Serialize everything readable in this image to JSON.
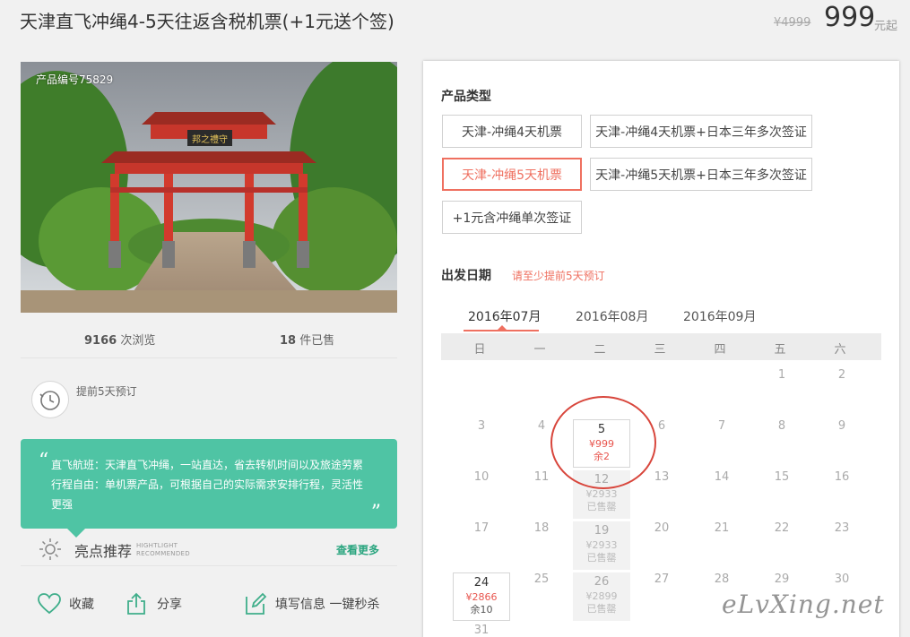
{
  "header": {
    "title": "天津直飞冲绳4-5天往返含税机票(+1元送个签)",
    "price_old": "¥4999",
    "price_now": "999",
    "price_unit": "元起"
  },
  "product": {
    "code_label": "产品编号75829",
    "views_count": "9166",
    "views_label": " 次浏览",
    "sold_count": "18",
    "sold_label": " 件已售",
    "advance_text": "提前5天预订",
    "intro_lines": [
      "直飞航班：天津直飞冲绳，一站直达，省去转机时间以及旅途劳累",
      "行程自由：单机票产品，可根据自己的实际需求安排行程，灵活性",
      "更强"
    ],
    "highlight_title": "亮点推荐",
    "highlight_en_1": "HIGHTLIGHT",
    "highlight_en_2": "RECOMMENDED",
    "more_label": "查看更多"
  },
  "actions": {
    "favorite": "收藏",
    "share": "分享",
    "quick_buy": "填写信息 一键秒杀"
  },
  "booking": {
    "type_title": "产品类型",
    "options": [
      "天津-冲绳4天机票",
      "天津-冲绳4天机票+日本三年多次签证",
      "天津-冲绳5天机票",
      "天津-冲绳5天机票+日本三年多次签证",
      "+1元含冲绳单次签证"
    ],
    "selected_option": 2,
    "date_title": "出发日期",
    "date_note": "请至少提前5天预订",
    "months": [
      "2016年07月",
      "2016年08月",
      "2016年09月"
    ],
    "active_month": 0,
    "weekdays": [
      "日",
      "一",
      "二",
      "三",
      "四",
      "五",
      "六"
    ],
    "days": {
      "d1": "1",
      "d2": "2",
      "d3": "3",
      "d4": "4",
      "d5": "5",
      "d6": "6",
      "d7": "7",
      "d8": "8",
      "d9": "9",
      "d10": "10",
      "d11": "11",
      "d12": "12",
      "d13": "13",
      "d14": "14",
      "d15": "15",
      "d16": "16",
      "d17": "17",
      "d18": "18",
      "d19": "19",
      "d20": "20",
      "d21": "21",
      "d22": "22",
      "d23": "23",
      "d24": "24",
      "d25": "25",
      "d26": "26",
      "d27": "27",
      "d28": "28",
      "d29": "29",
      "d30": "30",
      "d31": "31"
    },
    "prices": {
      "d5": {
        "price": "¥999",
        "remain": "余2"
      },
      "d12": {
        "price": "¥2933",
        "remain": "已售罄"
      },
      "d19": {
        "price": "¥2933",
        "remain": "已售罄"
      },
      "d24": {
        "price": "¥2866",
        "remain": "余10"
      },
      "d26": {
        "price": "¥2899",
        "remain": "已售罄"
      }
    }
  },
  "watermark": "eLvXing.net",
  "colors": {
    "accent": "#ef7060",
    "green": "#4fc4a4",
    "circle": "#d8463c"
  }
}
